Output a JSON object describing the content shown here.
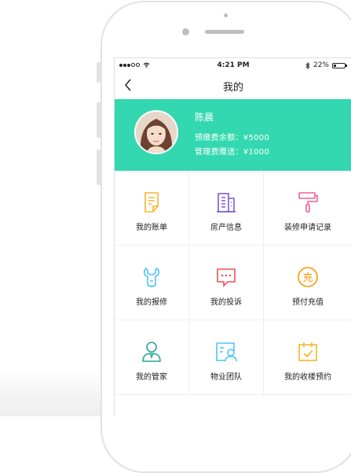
{
  "status_bar": {
    "time": "4:21 PM",
    "battery": "22%",
    "battery_level": 0.22
  },
  "nav": {
    "back_icon": "chevron-left-icon",
    "title": "我的"
  },
  "profile": {
    "name": "陈晨",
    "prepaid_balance": "预缴费余额：¥5000",
    "management_gift": "管理费赠送：¥1000",
    "background_color": "#33d8b0"
  },
  "menu": {
    "items": [
      {
        "label": "我的账单",
        "icon": "bill-icon",
        "color": "#f7b52c"
      },
      {
        "label": "房产信息",
        "icon": "building-icon",
        "color": "#7b5cd6"
      },
      {
        "label": "装修申请记录",
        "icon": "paint-roller-icon",
        "color": "#f06292"
      },
      {
        "label": "我的报修",
        "icon": "wrench-icon",
        "color": "#4fc3f7"
      },
      {
        "label": "我的投诉",
        "icon": "chat-bubble-icon",
        "color": "#ef5350"
      },
      {
        "label": "预付充值",
        "icon": "recharge-icon",
        "color": "#ff9800"
      },
      {
        "label": "我的管家",
        "icon": "butler-icon",
        "color": "#26a69a"
      },
      {
        "label": "物业团队",
        "icon": "team-icon",
        "color": "#4fc3f7"
      },
      {
        "label": "我的收楼预约",
        "icon": "calendar-check-icon",
        "color": "#f7b52c"
      }
    ]
  }
}
